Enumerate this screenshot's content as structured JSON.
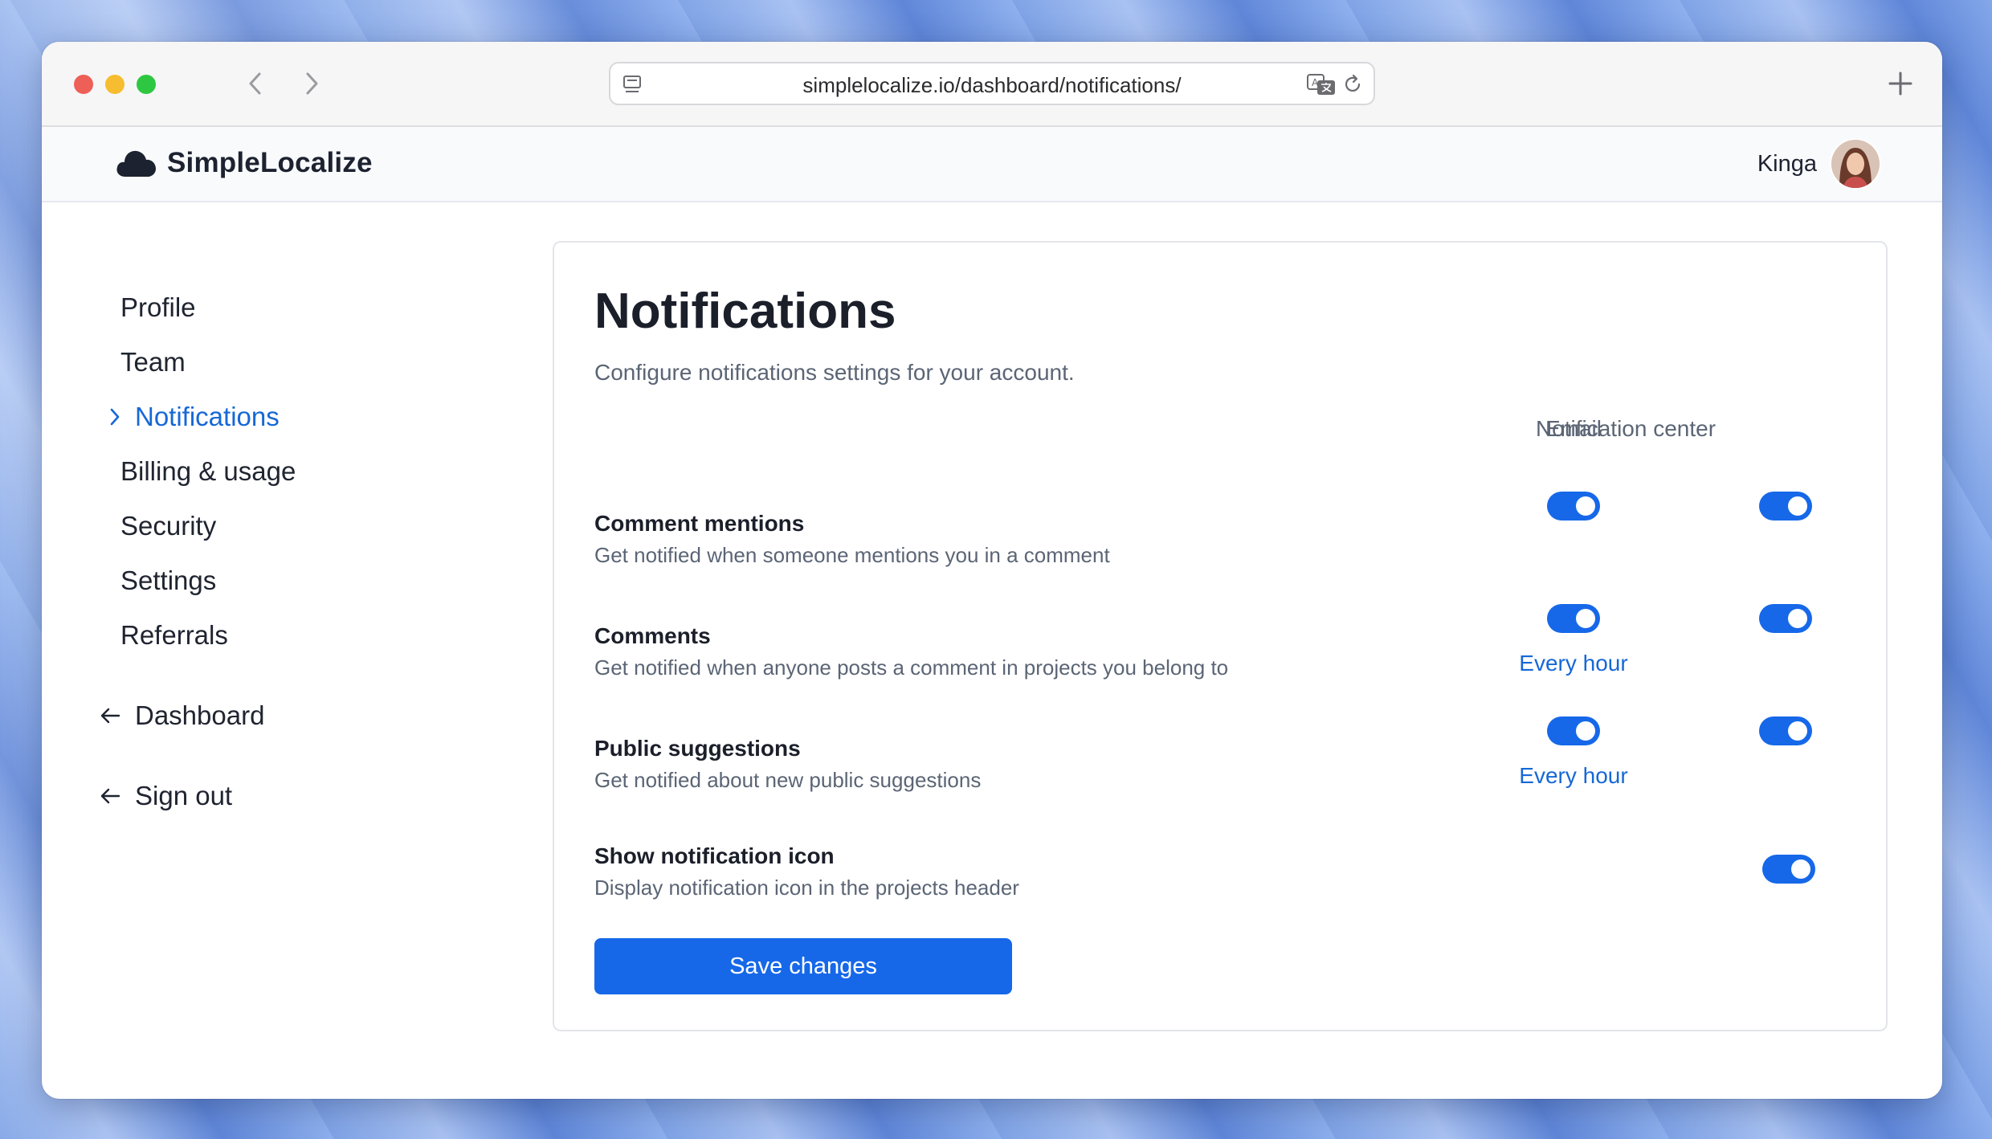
{
  "browser": {
    "url": "simplelocalize.io/dashboard/notifications/"
  },
  "header": {
    "brand": "SimpleLocalize",
    "user_name": "Kinga"
  },
  "sidebar": {
    "items": [
      {
        "label": "Profile"
      },
      {
        "label": "Team"
      },
      {
        "label": "Notifications",
        "active": true
      },
      {
        "label": "Billing & usage"
      },
      {
        "label": "Security"
      },
      {
        "label": "Settings"
      },
      {
        "label": "Referrals"
      }
    ],
    "dashboard_label": "Dashboard",
    "signout_label": "Sign out"
  },
  "main": {
    "title": "Notifications",
    "subtitle": "Configure notifications settings for your account.",
    "columns": {
      "email": "Email",
      "notification_center": "Notification center"
    },
    "rows": [
      {
        "title": "Comment mentions",
        "description": "Get notified when someone mentions you in a comment",
        "email_on": true,
        "center_on": true
      },
      {
        "title": "Comments",
        "description": "Get notified when anyone posts a comment in projects you belong to",
        "email_on": true,
        "center_on": true,
        "email_frequency": "Every hour"
      },
      {
        "title": "Public suggestions",
        "description": "Get notified about new public suggestions",
        "email_on": true,
        "center_on": true,
        "email_frequency": "Every hour"
      },
      {
        "title": "Show notification icon",
        "description": "Display notification icon in the projects header",
        "center_on": true
      }
    ],
    "save_label": "Save changes"
  },
  "colors": {
    "accent": "#1668e8",
    "link": "#1668d6"
  }
}
